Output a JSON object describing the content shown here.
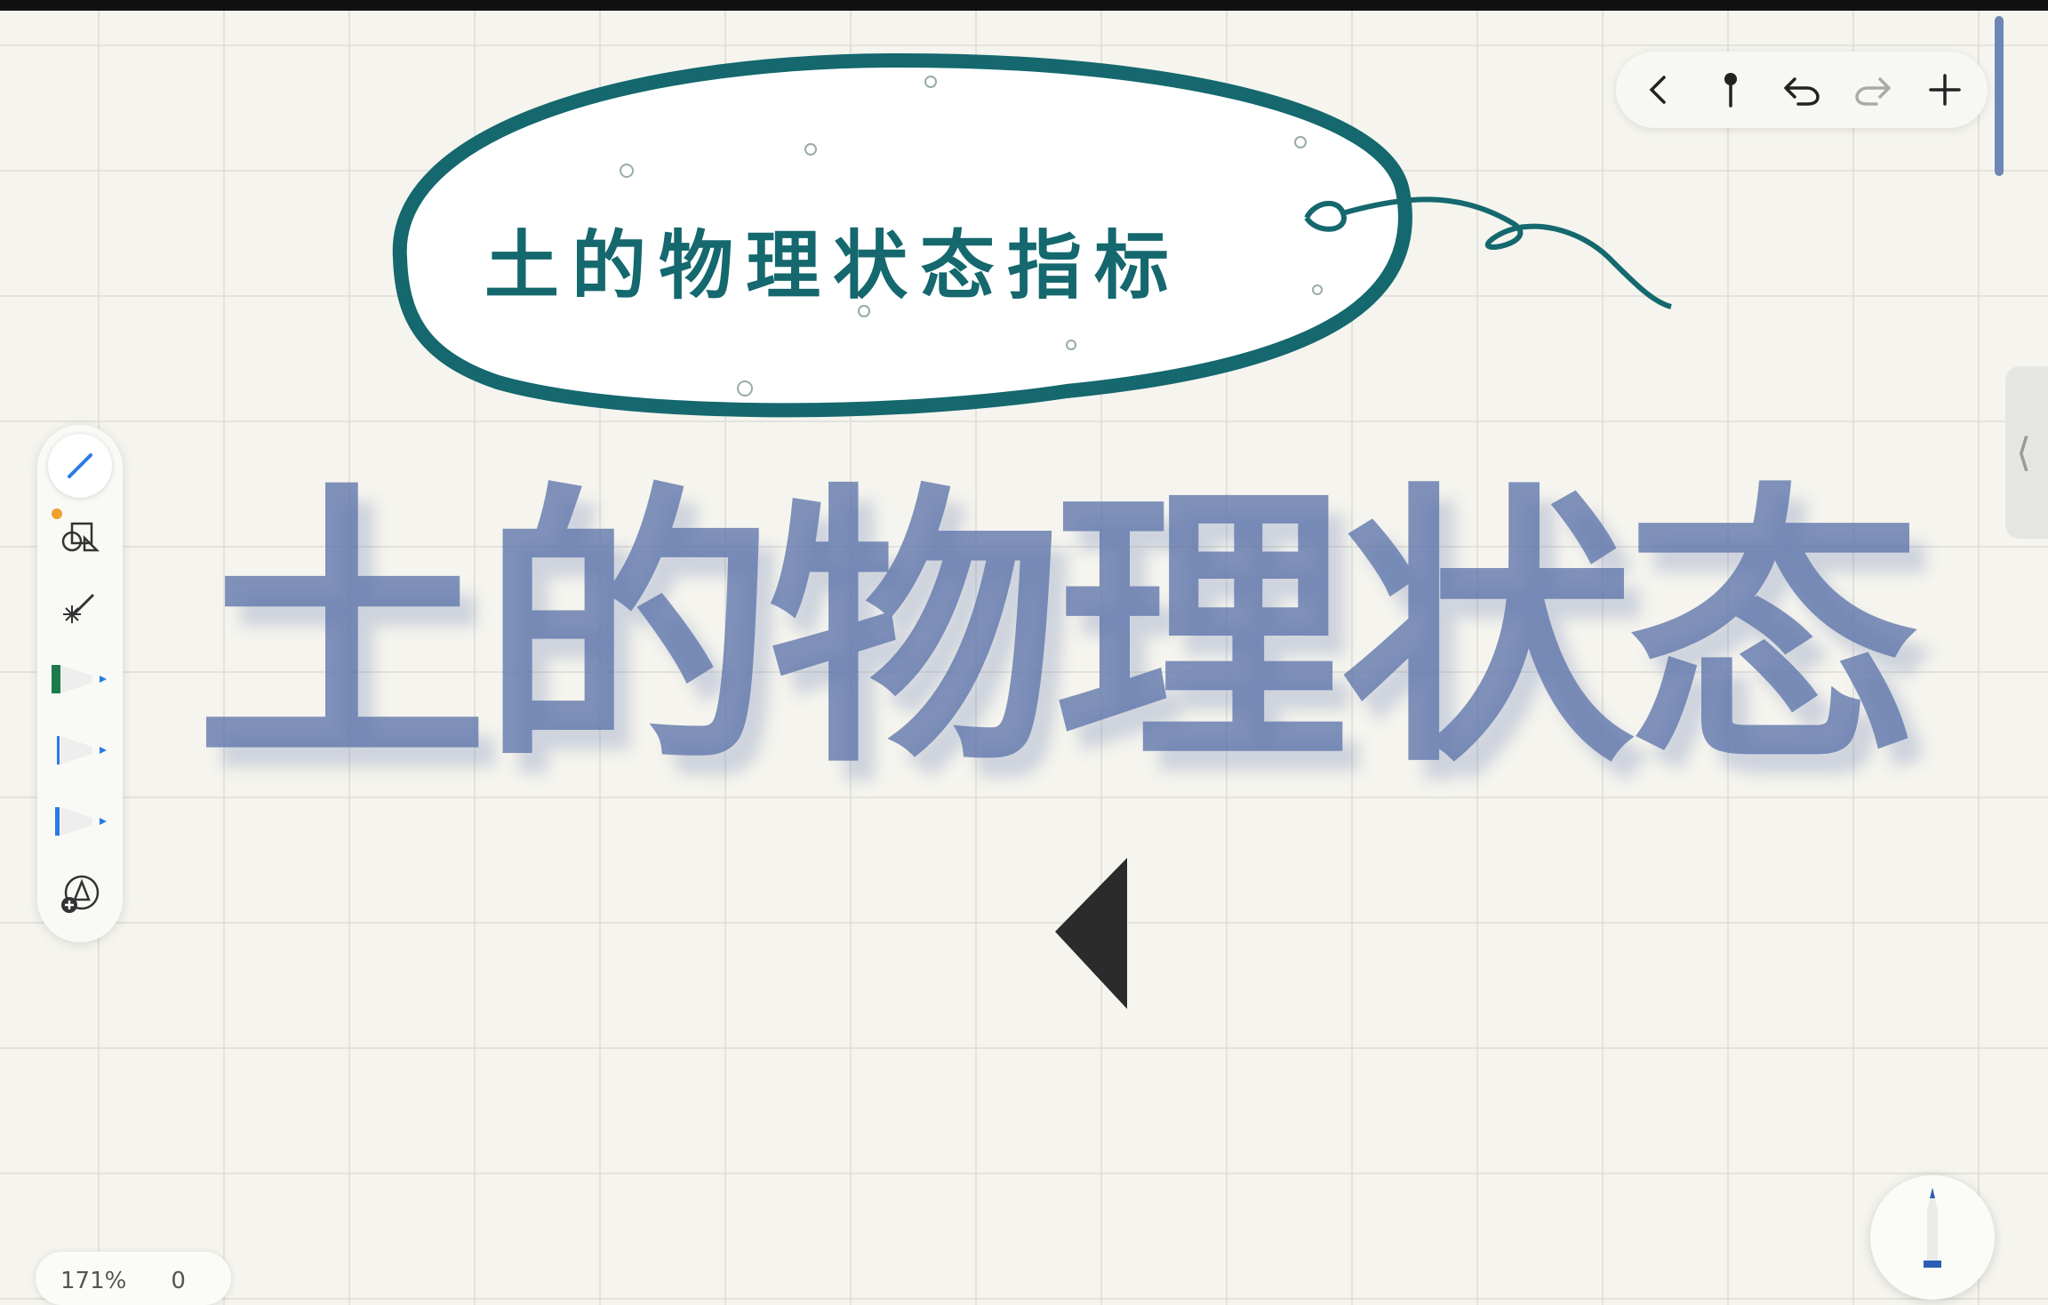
{
  "canvas": {
    "title_bubble_text": "土的物理状态指标",
    "handwritten_text": "土的物理状态"
  },
  "top_toolbar": {
    "back_icon": "chevron-left-icon",
    "pin_icon": "pin-icon",
    "undo_icon": "undo-icon",
    "redo_icon": "redo-icon",
    "add_icon": "plus-icon"
  },
  "side_toolbar": {
    "tools": [
      "pencil-icon",
      "shapes-icon",
      "laser-pointer-icon",
      "pen-green-icon",
      "pen-blue-thin-icon",
      "pen-blue-icon",
      "add-tool-icon"
    ]
  },
  "zoom": {
    "level": "171%",
    "zoom_partial": "0"
  },
  "colors": {
    "title_teal": "#14686e",
    "handwriting_blue": "#5d74aa",
    "grid": "#e3e2dc",
    "background": "#f5f4ee"
  }
}
